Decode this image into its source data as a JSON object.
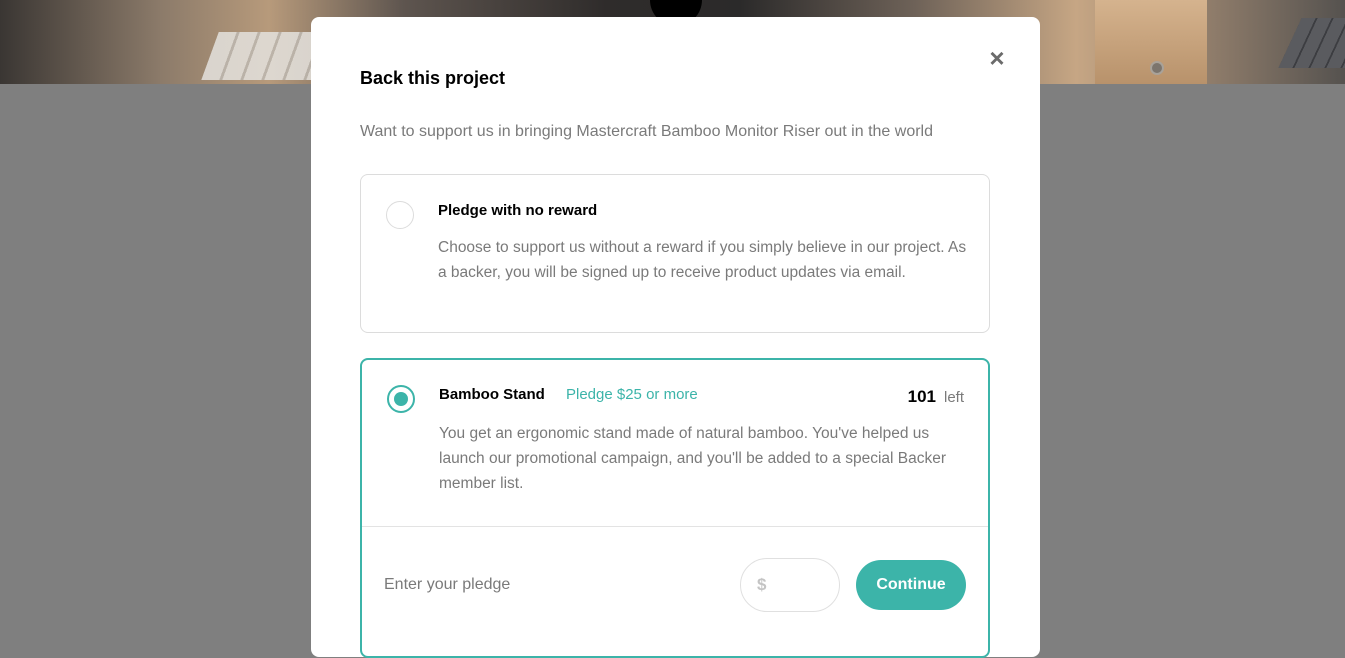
{
  "modal": {
    "close_symbol": "×",
    "title": "Back this project",
    "subtitle": "Want to support us in bringing Mastercraft Bamboo Monitor Riser out in the world"
  },
  "options": [
    {
      "title": "Pledge with no reward",
      "description": "Choose to support us without a reward if you simply believe in our project. As a backer, you will be signed up to receive product updates via email.",
      "selected": false
    },
    {
      "title": "Bamboo Stand",
      "pledge_min": "Pledge $25 or more",
      "left_count": "101",
      "left_label": "left",
      "description": "You get an ergonomic stand made of natural bamboo. You've helped us launch our promotional campaign, and you'll be added to a special Backer member list.",
      "selected": true,
      "pledge": {
        "label": "Enter your pledge",
        "currency": "$",
        "value": "",
        "continue_label": "Continue"
      }
    }
  ],
  "colors": {
    "accent": "#3cb4a9",
    "overlay": "#7f7f7f",
    "text_muted": "#7a7a7a"
  }
}
